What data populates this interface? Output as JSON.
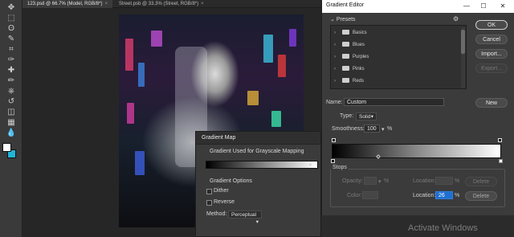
{
  "tabs": [
    {
      "label": "123.psd @ 66.7% (Model, RGB/8*)",
      "close": "×"
    },
    {
      "label": "Street.psb @ 33.3% (Street, RGB/8*)",
      "close": "×"
    }
  ],
  "toolbar": {
    "icons": [
      "move-icon",
      "marquee-icon",
      "lasso-icon",
      "quick-select-icon",
      "crop-icon",
      "eyedropper-icon",
      "healing-icon",
      "brush-icon",
      "stamp-icon",
      "history-brush-icon",
      "eraser-icon",
      "gradient-icon",
      "blur-icon",
      "dodge-icon",
      "pen-icon",
      "type-icon",
      "path-select-icon",
      "shape-icon",
      "hand-icon",
      "zoom-icon"
    ],
    "glyphs": [
      "✥",
      "⬚",
      "ʘ",
      "✎",
      "⌗",
      "✑",
      "✚",
      "✏",
      "⎈",
      "↺",
      "◫",
      "▦",
      "💧",
      "◐",
      "✒",
      "T",
      "➤",
      "▭",
      "✋",
      "⚲"
    ],
    "foreground_color": "#ffffff",
    "background_color": "#1fb5d6"
  },
  "gradient_map": {
    "title": "Gradient Map",
    "used_for_label": "Gradient Used for Grayscale Mapping",
    "options_label": "Gradient Options",
    "dither_label": "Dither",
    "reverse_label": "Reverse",
    "method_label": "Method:",
    "method_value": "Perceptual"
  },
  "gradient_editor": {
    "title": "Gradient Editor",
    "presets_label": "Presets",
    "preset_folders": [
      "Basics",
      "Blues",
      "Purples",
      "Pinks",
      "Reds"
    ],
    "buttons": {
      "ok": "OK",
      "cancel": "Cancel",
      "import": "Import...",
      "export": "Export...",
      "new": "New",
      "delete": "Delete"
    },
    "name_label": "Name:",
    "name_value": "Custom",
    "type_label": "Type:",
    "type_value": "Solid",
    "smoothness_label": "Smoothness:",
    "smoothness_value": "100",
    "percent": "%",
    "stops_label": "Stops",
    "opacity_label": "Opacity:",
    "color_label": "Color:",
    "location_label": "Location:",
    "location_active_value": "26",
    "gradient_start_color": "#000000",
    "gradient_end_color": "#ffffff"
  },
  "watermark": "Activate Windows"
}
